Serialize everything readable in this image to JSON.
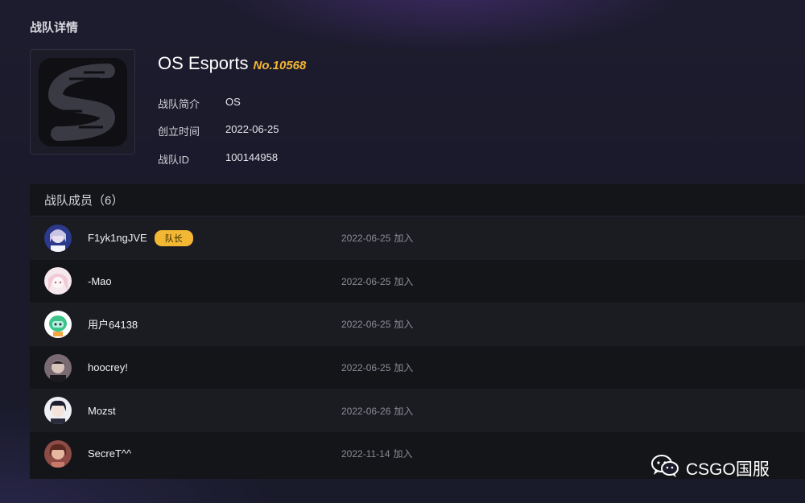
{
  "page": {
    "section_title": "战队详情"
  },
  "team": {
    "name": "OS Esports",
    "number": "No.10568",
    "info": [
      {
        "label": "战队简介",
        "value": "OS"
      },
      {
        "label": "创立时间",
        "value": "2022-06-25"
      },
      {
        "label": "战队ID",
        "value": "100144958"
      }
    ]
  },
  "members": {
    "header": "战队成员（6）",
    "joined_suffix": "加入",
    "captain_badge": "队长",
    "list": [
      {
        "name": "F1yk1ngJVE",
        "joined": "2022-06-25",
        "role": "captain",
        "avatar": "anime-avatar-blue"
      },
      {
        "name": "-Mao",
        "joined": "2022-06-25",
        "role": "member",
        "avatar": "anime-avatar-pink"
      },
      {
        "name": "用户64138",
        "joined": "2022-06-25",
        "role": "member",
        "avatar": "green-mascot-avatar"
      },
      {
        "name": "hoocrey!",
        "joined": "2022-06-25",
        "role": "member",
        "avatar": "dark-hair-avatar"
      },
      {
        "name": "Mozst",
        "joined": "2022-06-26",
        "role": "member",
        "avatar": "anime-boy-avatar"
      },
      {
        "name": "SecreT^^",
        "joined": "2022-11-14",
        "role": "member",
        "avatar": "portrait-avatar"
      }
    ]
  },
  "watermark": {
    "text": "CSGO国服",
    "icon": "wechat-icon"
  },
  "colors": {
    "accent": "#f2b733",
    "panel": "#141519",
    "row_alt": "#1b1c22"
  }
}
